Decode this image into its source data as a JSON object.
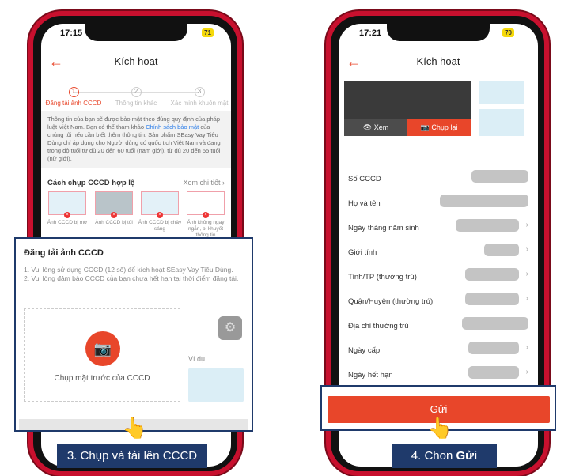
{
  "left": {
    "status": {
      "time": "17:15",
      "battery": "71"
    },
    "header": {
      "title": "Kích hoạt",
      "back_icon": "arrow-left-icon"
    },
    "steps": [
      {
        "num": "1",
        "label": "Đăng tải ảnh CCCD"
      },
      {
        "num": "2",
        "label": "Thông tin khác"
      },
      {
        "num": "3",
        "label": "Xác minh khuôn mặt"
      }
    ],
    "info": {
      "text1": "Thông tin của bạn sẽ được bảo mật theo đúng quy định của pháp luật Việt Nam. Bạn có thể tham khảo ",
      "link": "Chính sách bảo mật",
      "text2": " của chúng tôi nếu cần biết thêm thông tin. Sản phẩm SEasy Vay Tiêu Dùng chỉ áp dụng cho Người dùng có quốc tịch Việt Nam và đang trong độ tuổi từ đủ 20 đến 60 tuổi (nam giới), từ đủ 20 đến 55 tuổi (nữ giới)."
    },
    "guide": {
      "title": "Cách chụp CCCD hợp lệ",
      "more": "Xem chi tiết",
      "items": [
        "Ảnh CCCD bị mờ",
        "Ảnh CCCD bị tối",
        "Ảnh CCCD bị chảy sáng",
        "Ảnh không ngay ngắn, bị khuyết thông tin"
      ]
    },
    "panel": {
      "title": "Đăng tải ảnh CCCD",
      "notes": [
        "1. Vui lòng sử dụng CCCD (12 số) để kích hoạt SEasy Vay Tiêu Dùng.",
        "2. Vui lòng đảm bảo CCCD của bạn chưa hết hạn tại thời điểm đăng tải."
      ],
      "capture_label": "Chụp mặt trước của CCCD",
      "example_label": "Ví dụ"
    },
    "caption": "3. Chụp và tải lên CCCD"
  },
  "right": {
    "status": {
      "time": "17:21",
      "battery": "70"
    },
    "header": {
      "title": "Kích hoạt"
    },
    "photo": {
      "view": "Xem",
      "retake": "Chụp lại"
    },
    "fields": [
      {
        "label": "Số CCCD",
        "chev": false
      },
      {
        "label": "Họ và tên",
        "chev": false
      },
      {
        "label": "Ngày tháng năm sinh",
        "chev": true
      },
      {
        "label": "Giới tính",
        "chev": true
      },
      {
        "label": "Tỉnh/TP (thường trú)",
        "chev": true
      },
      {
        "label": "Quận/Huyện (thường trú)",
        "chev": true
      },
      {
        "label": "Địa chỉ thường trú",
        "chev": false
      },
      {
        "label": "Ngày cấp",
        "chev": true
      },
      {
        "label": "Ngày hết hạn",
        "chev": true
      }
    ],
    "submit": "Gửi",
    "caption_prefix": "4. Chon ",
    "caption_bold": "Gửi"
  },
  "colors": {
    "accent": "#e8462a",
    "navy": "#1f3a6b",
    "frame": "#c8102e"
  }
}
